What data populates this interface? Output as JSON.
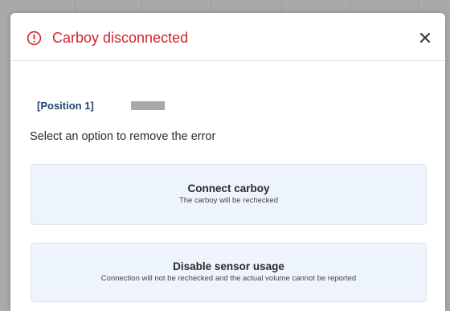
{
  "dialog": {
    "title": "Carboy disconnected",
    "title_color": "#d2232a",
    "alert_icon": "alert-circle-icon",
    "close_icon": "close-icon"
  },
  "position": {
    "label": "[Position 1]"
  },
  "instruction": "Select an option to remove the error",
  "options": [
    {
      "title": "Connect carboy",
      "description": "The carboy will be rechecked"
    },
    {
      "title": "Disable sensor usage",
      "description": "Connection will not be rechecked and the actual volume cannot be reported"
    }
  ]
}
